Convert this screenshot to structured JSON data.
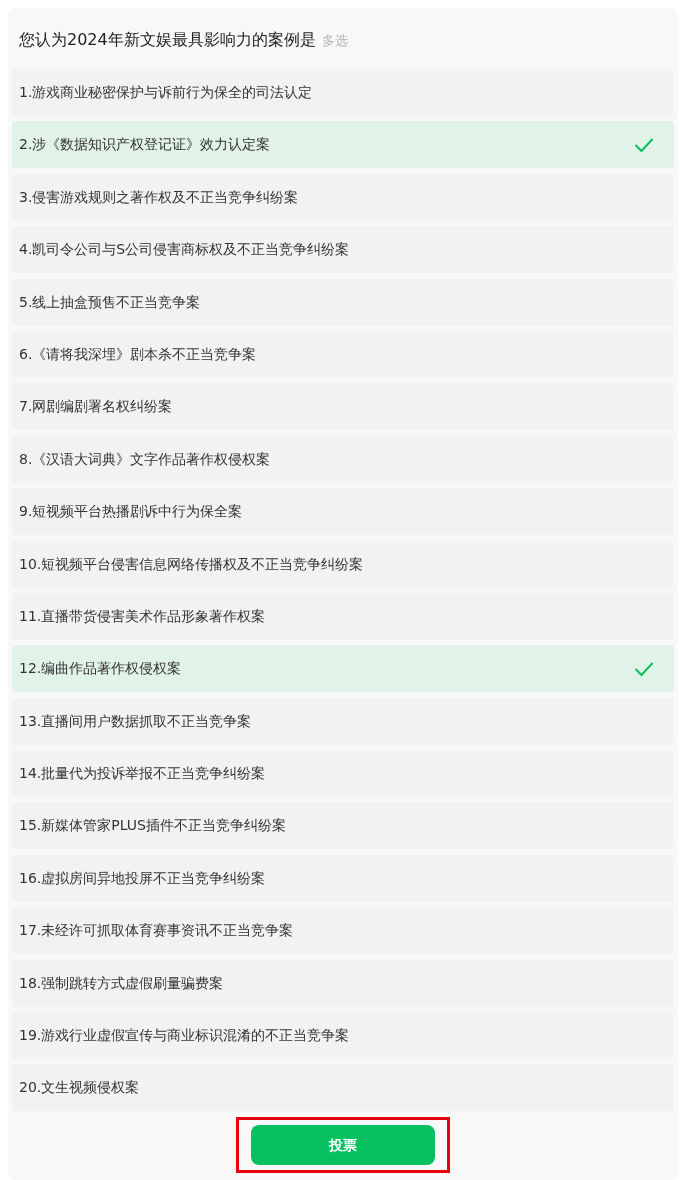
{
  "question": {
    "title": "您认为2024年新文娱最具影响力的案例是",
    "tag": "多选"
  },
  "options": [
    {
      "label": "1.游戏商业秘密保护与诉前行为保全的司法认定",
      "selected": false
    },
    {
      "label": "2.涉《数据知识产权登记证》效力认定案",
      "selected": true
    },
    {
      "label": "3.侵害游戏规则之著作权及不正当竞争纠纷案",
      "selected": false
    },
    {
      "label": "4.凯司令公司与S公司侵害商标权及不正当竞争纠纷案",
      "selected": false
    },
    {
      "label": "5.线上抽盒预售不正当竞争案",
      "selected": false
    },
    {
      "label": "6.《请将我深埋》剧本杀不正当竞争案",
      "selected": false
    },
    {
      "label": "7.网剧编剧署名权纠纷案",
      "selected": false
    },
    {
      "label": "8.《汉语大词典》文字作品著作权侵权案",
      "selected": false
    },
    {
      "label": "9.短视频平台热播剧诉中行为保全案",
      "selected": false
    },
    {
      "label": "10.短视频平台侵害信息网络传播权及不正当竞争纠纷案",
      "selected": false
    },
    {
      "label": "11.直播带货侵害美术作品形象著作权案",
      "selected": false
    },
    {
      "label": "12.编曲作品著作权侵权案",
      "selected": true
    },
    {
      "label": "13.直播间用户数据抓取不正当竞争案",
      "selected": false
    },
    {
      "label": "14.批量代为投诉举报不正当竞争纠纷案",
      "selected": false
    },
    {
      "label": "15.新媒体管家PLUS插件不正当竞争纠纷案",
      "selected": false
    },
    {
      "label": "16.虚拟房间异地投屏不正当竞争纠纷案",
      "selected": false
    },
    {
      "label": "17.未经许可抓取体育赛事资讯不正当竞争案",
      "selected": false
    },
    {
      "label": "18.强制跳转方式虚假刷量骗费案",
      "selected": false
    },
    {
      "label": "19.游戏行业虚假宣传与商业标识混淆的不正当竞争案",
      "selected": false
    },
    {
      "label": "20.文生视频侵权案",
      "selected": false
    }
  ],
  "vote_button": {
    "label": "投票",
    "highlighted": true
  }
}
